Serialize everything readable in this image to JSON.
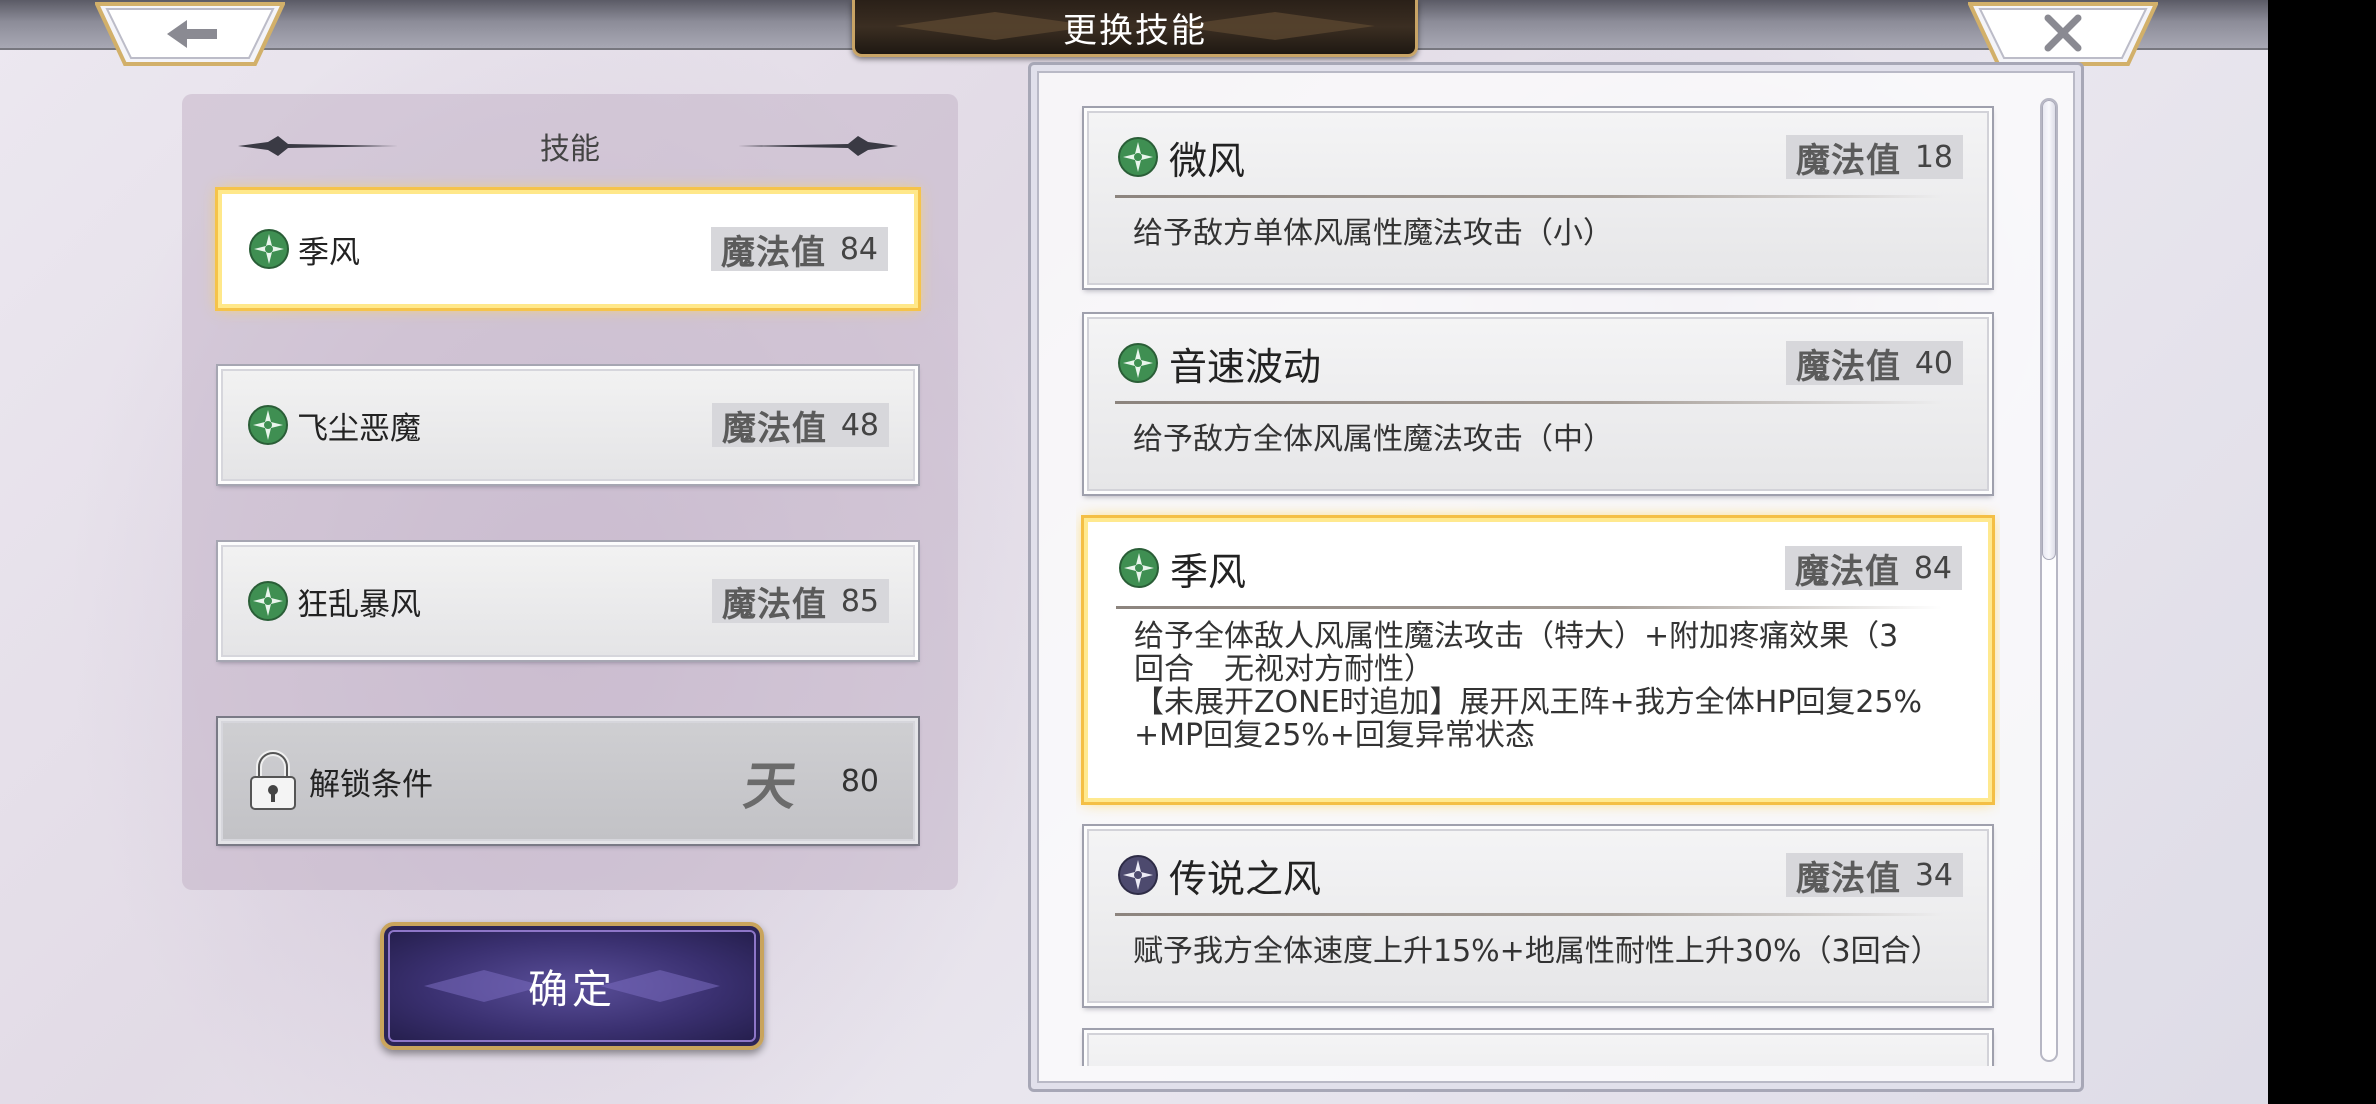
{
  "header": {
    "title": "更换技能",
    "back_icon": "arrow-left-icon",
    "close_icon": "close-x-icon"
  },
  "left_panel": {
    "heading": "技能",
    "slots": [
      {
        "name": "季风",
        "mp_label": "魔法值",
        "mp": "84",
        "selected": true,
        "icon": "wind-icon"
      },
      {
        "name": "飞尘恶魔",
        "mp_label": "魔法值",
        "mp": "48",
        "selected": false,
        "icon": "wind-icon"
      },
      {
        "name": "狂乱暴风",
        "mp_label": "魔法值",
        "mp": "85",
        "selected": false,
        "icon": "wind-icon"
      }
    ],
    "locked_slot": {
      "label": "解锁条件",
      "glyph": "天",
      "value": "80",
      "icon": "padlock-icon"
    }
  },
  "confirm_button": {
    "label": "确定"
  },
  "skill_list": [
    {
      "name": "微风",
      "mp_label": "魔法值",
      "mp": "18",
      "icon": "wind-icon",
      "icon_color": "#3f8f52",
      "desc": [
        "给予敌方单体风属性魔法攻击（小）"
      ]
    },
    {
      "name": "音速波动",
      "mp_label": "魔法值",
      "mp": "40",
      "icon": "wind-icon",
      "icon_color": "#3f8f52",
      "desc": [
        "给予敌方全体风属性魔法攻击（中）"
      ]
    },
    {
      "name": "季风",
      "mp_label": "魔法值",
      "mp": "84",
      "icon": "wind-icon",
      "icon_color": "#3f8f52",
      "selected": true,
      "desc": [
        "给予全体敌人风属性魔法攻击（特大）+附加疼痛效果（3",
        "回合　无视对方耐性）",
        "【未展开ZONE时追加】展开风王阵+我方全体HP回复25%",
        "+MP回复25%+回复异常状态"
      ]
    },
    {
      "name": "传说之风",
      "mp_label": "魔法值",
      "mp": "34",
      "icon": "wind-icon",
      "icon_color": "#4d4a6e",
      "desc": [
        "赋予我方全体速度上升15%+地属性耐性上升30%（3回合）"
      ]
    }
  ],
  "colors": {
    "selected_border": "#f4bf45",
    "wind_green": "#3f8f52",
    "title_plate": "#2a2018",
    "confirm_purple": "#3a3070"
  }
}
